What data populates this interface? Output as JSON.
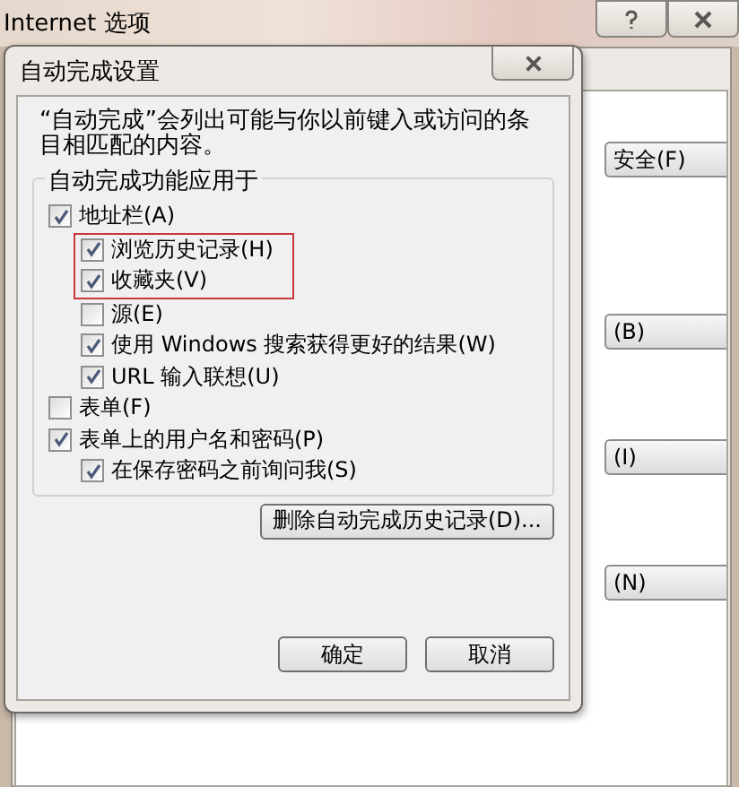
{
  "window": {
    "title": "Internet 选项",
    "right_buttons": [
      "安全(F)",
      "(B)",
      "(I)",
      "(N)"
    ]
  },
  "dialog": {
    "title": "自动完成设置",
    "description": "“自动完成”会列出可能与你以前键入或访问的条目相匹配的内容。",
    "group_title": "自动完成功能应用于",
    "options": [
      {
        "label": "地址栏(A)",
        "checked": true,
        "children": [
          {
            "label": "浏览历史记录(H)",
            "checked": true,
            "highlighted": true
          },
          {
            "label": "收藏夹(V)",
            "checked": true,
            "highlighted": true
          },
          {
            "label": "源(E)",
            "checked": false,
            "highlighted": false
          },
          {
            "label": "使用 Windows 搜索获得更好的结果(W)",
            "checked": true,
            "highlighted": false
          },
          {
            "label": "URL 输入联想(U)",
            "checked": true,
            "highlighted": false
          }
        ]
      },
      {
        "label": "表单(F)",
        "checked": false
      },
      {
        "label": "表单上的用户名和密码(P)",
        "checked": true,
        "children": [
          {
            "label": "在保存密码之前询问我(S)",
            "checked": true,
            "highlighted": false
          }
        ]
      }
    ],
    "delete_button": "删除自动完成历史记录(D)...",
    "buttons": [
      "确定",
      "取消"
    ]
  }
}
